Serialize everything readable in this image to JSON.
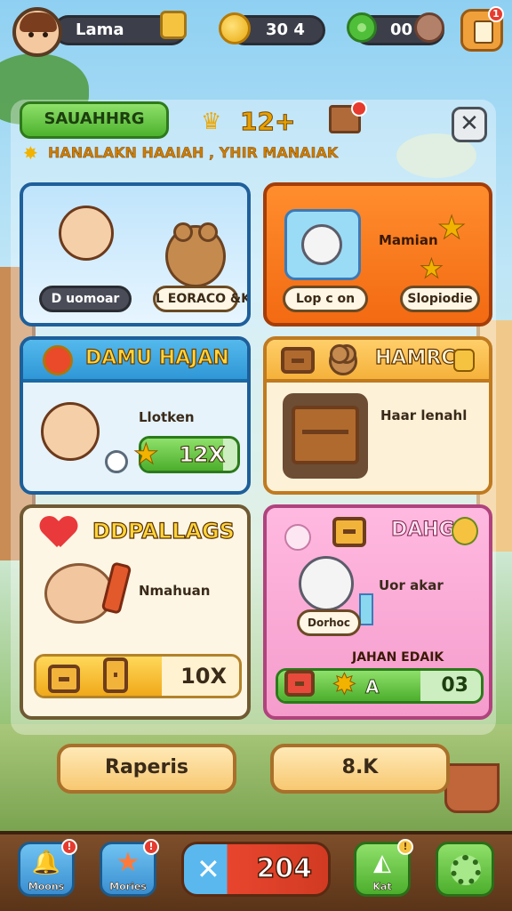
{
  "topbar": {
    "player_name": "Lama",
    "coins": "30 4",
    "gems": "00",
    "menu_badge": "1"
  },
  "header": {
    "title_button": "SAUAHHRG",
    "count": "12+",
    "subtitle": "HANALAKN HAAIAH , YHIR MANAIAK",
    "close_symbol": "✕"
  },
  "cards": {
    "card1": {
      "chip_left": "D uomoar",
      "chip_right": "L EORACO &K"
    },
    "card2": {
      "name": "Mamian",
      "chip_left": "Lop c on",
      "chip_right": "Slopiodie"
    },
    "card3": {
      "title": "DAMU HAJAN",
      "label": "Llotken",
      "progress_value": "12X",
      "progress_fraction": 0.85
    },
    "card4": {
      "title": "HAMRC",
      "label": "Haar lenahl"
    },
    "card5": {
      "title": "DDPALLAGS",
      "label": "Nmahuan",
      "progress_value": "10X",
      "progress_fraction": 0.62
    },
    "card6": {
      "title": "DAHG",
      "label": "Uor akar",
      "chip": "Dorhoc",
      "sub_title": "JAHAN EDAIK",
      "bar_left": "A",
      "bar_right": "03",
      "progress_fraction": 0.7
    }
  },
  "buttons": {
    "left": "Raperis",
    "right": "8.K"
  },
  "bottom_nav": {
    "item1_label": "Moons",
    "item2_label": "Mories",
    "center_value": "204",
    "item4_label": "Kat",
    "item5_icon": "gear-icon",
    "badge": "!"
  },
  "colors": {
    "accent_green": "#4db22d",
    "accent_orange": "#f36a12",
    "accent_blue": "#2f97d6",
    "accent_pink": "#f59ccc",
    "gold": "#f2b200"
  }
}
